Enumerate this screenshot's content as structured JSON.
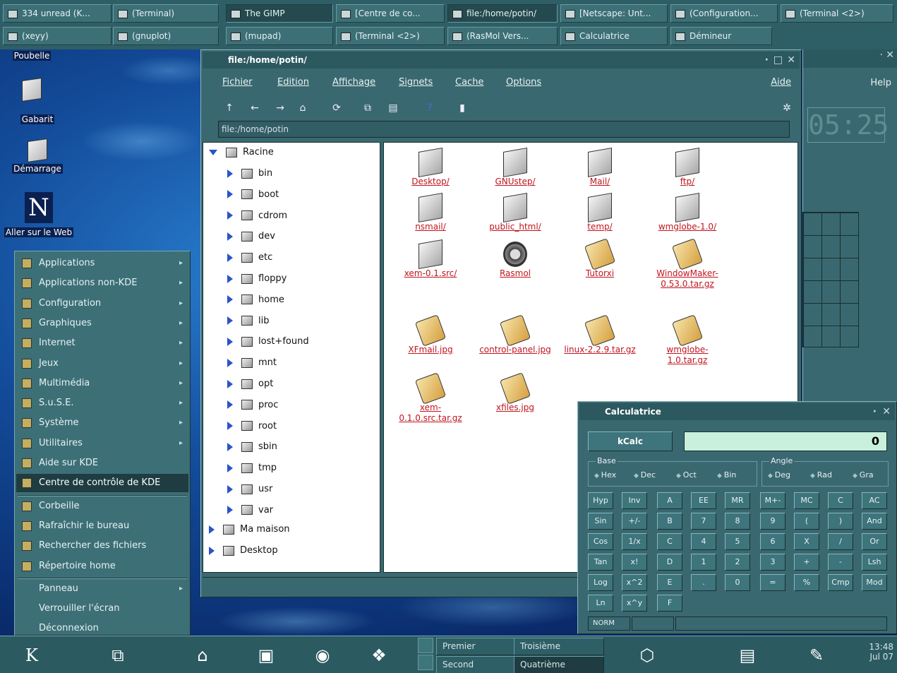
{
  "taskbar_top_row1": [
    {
      "label": "334 unread (K..."
    },
    {
      "label": "(Terminal)"
    },
    {
      "label": "The GIMP"
    },
    {
      "label": "[Centre de co..."
    },
    {
      "label": "file:/home/potin/"
    },
    {
      "label": "[Netscape: Unt..."
    },
    {
      "label": "(Configuration..."
    },
    {
      "label": "(Terminal <2>)"
    }
  ],
  "taskbar_top_row2": [
    {
      "label": "(xeyy)"
    },
    {
      "label": "(gnuplot)"
    },
    {
      "label": "(mupad)"
    },
    {
      "label": "(Terminal <2>)"
    },
    {
      "label": "(RasMol Vers..."
    },
    {
      "label": "Calculatrice"
    },
    {
      "label": "Démineur"
    }
  ],
  "desktop_icons": [
    {
      "label": "Poubelle"
    },
    {
      "label": "Gabarit"
    },
    {
      "label": "Démarrage"
    },
    {
      "label": "Aller sur le Web"
    }
  ],
  "start_menu": {
    "items": [
      {
        "label": "Applications",
        "submenu": true
      },
      {
        "label": "Applications non-KDE",
        "submenu": true
      },
      {
        "label": "Configuration",
        "submenu": true
      },
      {
        "label": "Graphiques",
        "submenu": true
      },
      {
        "label": "Internet",
        "submenu": true
      },
      {
        "label": "Jeux",
        "submenu": true
      },
      {
        "label": "Multimédia",
        "submenu": true
      },
      {
        "label": "S.u.S.E.",
        "submenu": true
      },
      {
        "label": "Système",
        "submenu": true
      },
      {
        "label": "Utilitaires",
        "submenu": true
      },
      {
        "label": "Aide sur KDE",
        "submenu": false
      },
      {
        "label": "Centre de contrôle de KDE",
        "submenu": false
      },
      {
        "label": "Corbeille",
        "submenu": false
      },
      {
        "label": "Rafraîchir le bureau",
        "submenu": false
      },
      {
        "label": "Rechercher des fichiers",
        "submenu": false
      },
      {
        "label": "Répertoire home",
        "submenu": false
      },
      {
        "label": "Panneau",
        "submenu": true
      },
      {
        "label": "Verrouiller l'écran",
        "submenu": false
      },
      {
        "label": "Déconnexion",
        "submenu": false
      }
    ]
  },
  "file_manager": {
    "title": "file:/home/potin/",
    "menubar": [
      "Fichier",
      "Edition",
      "Affichage",
      "Signets",
      "Cache",
      "Options"
    ],
    "help": "Aide",
    "url": "file:/home/potin",
    "tree_root": "Racine",
    "tree_children": [
      "bin",
      "boot",
      "cdrom",
      "dev",
      "etc",
      "floppy",
      "home",
      "lib",
      "lost+found",
      "mnt",
      "opt",
      "proc",
      "root",
      "sbin",
      "tmp",
      "usr",
      "var"
    ],
    "tree_other": [
      "Ma maison",
      "Desktop"
    ],
    "files": [
      {
        "name": "Desktop/",
        "kind": "folder"
      },
      {
        "name": "GNUstep/",
        "kind": "folder"
      },
      {
        "name": "Mail/",
        "kind": "folder"
      },
      {
        "name": "ftp/",
        "kind": "folder"
      },
      {
        "name": "nsmail/",
        "kind": "folder"
      },
      {
        "name": "public_html/",
        "kind": "folder"
      },
      {
        "name": "temp/",
        "kind": "folder"
      },
      {
        "name": "wmglobe-1.0/",
        "kind": "folder"
      },
      {
        "name": "xem-0.1.src/",
        "kind": "folder"
      },
      {
        "name": "Rasmol",
        "kind": "gear"
      },
      {
        "name": "Tutorxi",
        "kind": "img"
      },
      {
        "name": "WindowMaker-0.53.0.tar.gz",
        "kind": "img"
      },
      {
        "name": "XFmail.jpg",
        "kind": "img"
      },
      {
        "name": "control-panel.jpg",
        "kind": "img"
      },
      {
        "name": "linux-2.2.9.tar.gz",
        "kind": "img"
      },
      {
        "name": "wmglobe-1.0.tar.gz",
        "kind": "img"
      },
      {
        "name": "xem-0.1.0.src.tar.gz",
        "kind": "img"
      },
      {
        "name": "xfiles.jpg",
        "kind": "img"
      }
    ]
  },
  "right_panel": {
    "help_label": "Help",
    "clock_digits": "05:25"
  },
  "calculator": {
    "title": "Calculatrice",
    "kcalc_label": "kCalc",
    "display": "0",
    "base_label": "Base",
    "angle_label": "Angle",
    "base_options": [
      "Hex",
      "Dec",
      "Oct",
      "Bin"
    ],
    "angle_options": [
      "Deg",
      "Rad",
      "Gra"
    ],
    "keys": [
      [
        "Hyp",
        "Inv",
        "A",
        "EE",
        "MR",
        "M+-",
        "MC",
        "C",
        "AC"
      ],
      [
        "Sin",
        "+/-",
        "B",
        "7",
        "8",
        "9",
        "(",
        ")",
        "And"
      ],
      [
        "Cos",
        "1/x",
        "C",
        "4",
        "5",
        "6",
        "X",
        "/",
        "Or"
      ],
      [
        "Tan",
        "x!",
        "D",
        "1",
        "2",
        "3",
        "+",
        "-",
        "Lsh"
      ],
      [
        "Log",
        "x^2",
        "E",
        ".",
        "0",
        "=",
        "%",
        "Cmp",
        "Mod"
      ],
      [
        "Ln",
        "x^y",
        "F"
      ]
    ],
    "status": "NORM"
  },
  "bottom_panel": {
    "desktops": [
      "Premier",
      "Troisième",
      "Second",
      "Quatrième"
    ],
    "time": "13:48",
    "date": "Jul 07"
  }
}
